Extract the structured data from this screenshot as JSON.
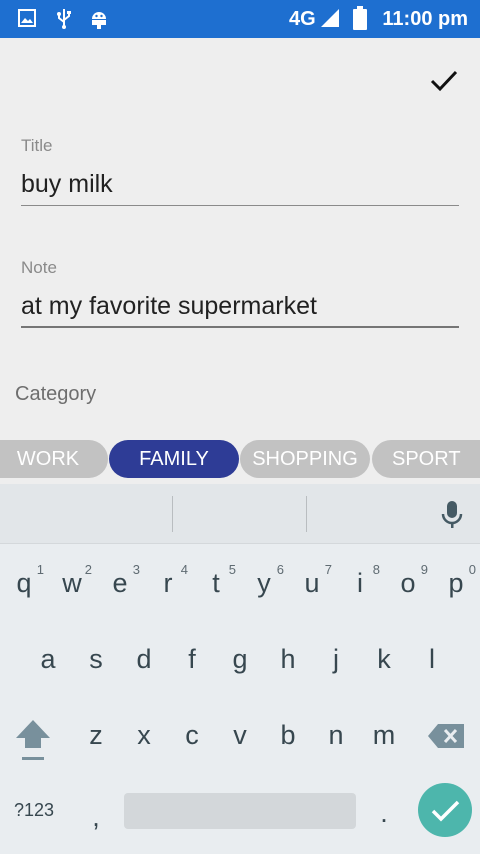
{
  "status_bar": {
    "network": "4G",
    "time": "11:00 pm",
    "icons": [
      "image-icon",
      "usb-icon",
      "android-icon",
      "signal-icon",
      "battery-icon"
    ]
  },
  "toolbar": {
    "confirm_icon": "check-icon"
  },
  "form": {
    "title_label": "Title",
    "title_value": "buy milk",
    "note_label": "Note",
    "note_value": "at my favorite supermarket",
    "category_label": "Category"
  },
  "categories": [
    {
      "label": "WORK",
      "selected": false
    },
    {
      "label": "FAMILY",
      "selected": true
    },
    {
      "label": "SHOPPING",
      "selected": false
    },
    {
      "label": "SPORT",
      "selected": false
    }
  ],
  "keyboard": {
    "row1": [
      "q",
      "w",
      "e",
      "r",
      "t",
      "y",
      "u",
      "i",
      "o",
      "p"
    ],
    "row1_hints": [
      "1",
      "2",
      "3",
      "4",
      "5",
      "6",
      "7",
      "8",
      "9",
      "0"
    ],
    "row2": [
      "a",
      "s",
      "d",
      "f",
      "g",
      "h",
      "j",
      "k",
      "l"
    ],
    "row3": [
      "z",
      "x",
      "c",
      "v",
      "b",
      "n",
      "m"
    ],
    "symbols_key": "?123",
    "comma_key": ",",
    "period_key": ".",
    "mic_icon": "mic-icon",
    "shift_icon": "shift-icon",
    "backspace_icon": "backspace-icon",
    "enter_icon": "check-icon"
  },
  "colors": {
    "status_bar": "#1e6fd0",
    "chip_selected": "#2e3c96",
    "chip_default": "#c2c2c2",
    "enter_key": "#4db6ac"
  }
}
